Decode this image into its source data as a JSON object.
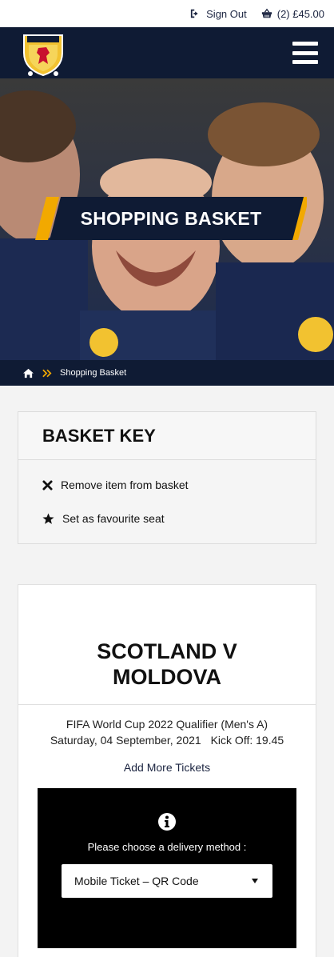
{
  "topbar": {
    "sign_out_label": "Sign Out",
    "basket_label": "(2) £45.00"
  },
  "hero": {
    "title": "SHOPPING BASKET"
  },
  "breadcrumb": {
    "current": "Shopping Basket"
  },
  "basket_key": {
    "title": "BASKET KEY",
    "items": [
      {
        "icon": "remove-icon",
        "label": "Remove item from basket"
      },
      {
        "icon": "star-icon",
        "label": "Set as favourite seat"
      }
    ]
  },
  "match": {
    "title": "SCOTLAND V MOLDOVA",
    "competition": "FIFA World Cup 2022 Qualifier (Men's A)",
    "date": "Saturday, 04 September, 2021",
    "kickoff": "Kick Off: 19.45",
    "add_more_label": "Add More Tickets",
    "delivery_label": "Please choose a delivery method :",
    "delivery_selected": "Mobile Ticket – QR Code"
  },
  "colors": {
    "navy": "#0f1b34",
    "accent": "#f2a900",
    "black": "#000000"
  }
}
